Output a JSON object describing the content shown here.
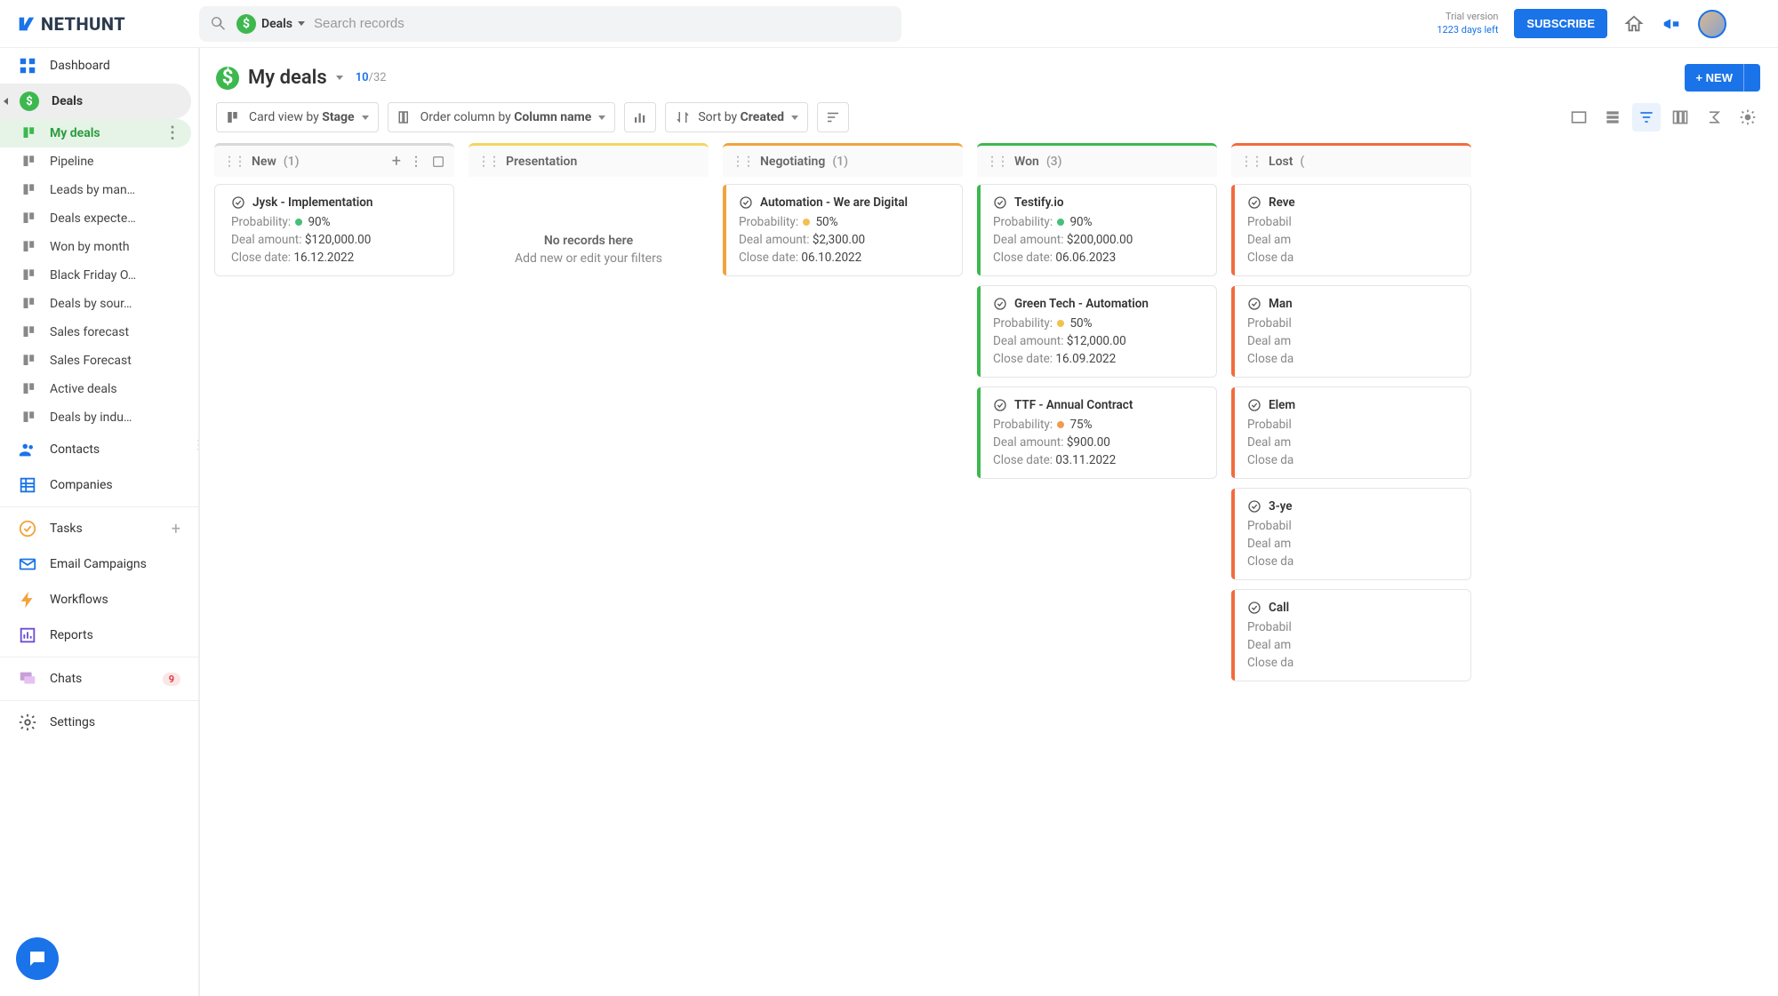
{
  "app": {
    "name": "NETHUNT"
  },
  "search": {
    "scope": "Deals",
    "placeholder": "Search records"
  },
  "trial": {
    "line1": "Trial version",
    "line2": "1223 days left"
  },
  "subscribe_label": "SUBSCRIBE",
  "sidebar": {
    "dashboard": "Dashboard",
    "deals": "Deals",
    "subitems": [
      "My deals",
      "Pipeline",
      "Leads by man…",
      "Deals expecte…",
      "Won by month",
      "Black Friday O…",
      "Deals by sour…",
      "Sales forecast",
      "Sales Forecast",
      "Active deals",
      "Deals by indu…"
    ],
    "contacts": "Contacts",
    "companies": "Companies",
    "tasks": "Tasks",
    "email_campaigns": "Email Campaigns",
    "workflows": "Workflows",
    "reports": "Reports",
    "chats": "Chats",
    "chats_badge": "9",
    "settings": "Settings"
  },
  "page": {
    "title": "My deals",
    "count_shown": "10",
    "count_total": "/32",
    "new_button": "+ NEW"
  },
  "toolbar": {
    "cardview_prefix": "Card view by ",
    "cardview_value": "Stage",
    "order_prefix": "Order column by ",
    "order_value": "Column name",
    "sort_prefix": "Sort by ",
    "sort_value": "Created"
  },
  "empty_col": {
    "title": "No records here",
    "sub": "Add new or edit your filters"
  },
  "field_labels": {
    "probability": "Probability:",
    "amount": "Deal amount:",
    "close": "Close date:"
  },
  "columns": [
    {
      "name": "New",
      "count": "(1)",
      "accent": "#d8d8d8",
      "show_actions": true,
      "cards": [
        {
          "title": "Jysk - Implementation",
          "probability": "90%",
          "prob_color": "#45c07a",
          "amount": "$120,000.00",
          "close": "16.12.2022",
          "accent": null
        }
      ]
    },
    {
      "name": "Presentation",
      "count": "",
      "accent": "#f4d55e",
      "show_actions": false,
      "cards": [],
      "empty": true
    },
    {
      "name": "Negotiating",
      "count": "(1)",
      "accent": "#f2a33c",
      "show_actions": false,
      "cards": [
        {
          "title": "Automation - We are Digital",
          "probability": "50%",
          "prob_color": "#f2c14e",
          "amount": "$2,300.00",
          "close": "06.10.2022",
          "accent": "#f2a33c"
        }
      ]
    },
    {
      "name": "Won",
      "count": "(3)",
      "accent": "#3db84e",
      "show_actions": false,
      "cards": [
        {
          "title": "Testify.io",
          "probability": "90%",
          "prob_color": "#45c07a",
          "amount": "$200,000.00",
          "close": "06.06.2023",
          "accent": "#3db84e"
        },
        {
          "title": "Green Tech - Automation",
          "probability": "50%",
          "prob_color": "#f2c14e",
          "amount": "$12,000.00",
          "close": "16.09.2022",
          "accent": "#3db84e"
        },
        {
          "title": "TTF - Annual Contract",
          "probability": "75%",
          "prob_color": "#f29b4e",
          "amount": "$900.00",
          "close": "03.11.2022",
          "accent": "#3db84e"
        }
      ]
    },
    {
      "name": "Lost",
      "count": "(",
      "accent": "#f26b3c",
      "show_actions": false,
      "cards": [
        {
          "title": "Reve",
          "probability_label_only": true,
          "amount_label_only": true,
          "close_label_only": true,
          "accent": "#f26b3c"
        },
        {
          "title": "Man",
          "probability_label_only": true,
          "amount_label_only": true,
          "close_label_only": true,
          "accent": "#f26b3c"
        },
        {
          "title": "Elem",
          "probability_label_only": true,
          "amount_label_only": true,
          "close_label_only": true,
          "accent": "#f26b3c"
        },
        {
          "title": "3-ye",
          "probability_label_only": true,
          "amount_label_only": true,
          "close_label_only": true,
          "accent": "#f26b3c"
        },
        {
          "title": "Call",
          "probability_label_only": true,
          "amount_label_only": true,
          "close_label_only": true,
          "accent": "#f26b3c"
        }
      ]
    }
  ],
  "truncated_labels": {
    "probability": "Probabil",
    "amount": "Deal am",
    "close": "Close da"
  }
}
